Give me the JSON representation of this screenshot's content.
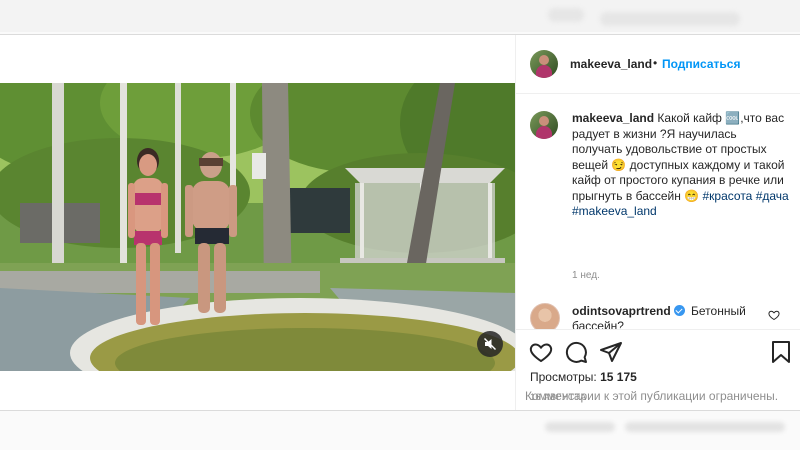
{
  "post": {
    "username": "makeeva_land",
    "dot": "•",
    "follow_label": "Подписаться",
    "caption_text": "Какой кайф 🆒,что вас радует в жизни ?Я научилась получать удовольствие от простых вещей 😏 доступных каждому и такой кайф от простого купания в речке или прыгнуть в бассейн 😁",
    "hashtags": [
      "#красота",
      "#дача",
      "#makeeva_land"
    ],
    "time_ago": "1 нед.",
    "views_label": "Просмотры:",
    "views_count": "15 175",
    "date": "16 АВГУСТА"
  },
  "comment": {
    "username": "odintsovaprtrend",
    "text": "Бетонный бассейн?"
  },
  "footer": {
    "restricted_text": "Комментарии к этой публикации ограничены."
  },
  "icons": {
    "like": "heart-icon",
    "comment": "comment-icon",
    "share": "share-icon",
    "save": "bookmark-icon",
    "mute": "muted-speaker-icon"
  },
  "colors": {
    "link": "#0095f6",
    "hashtag": "#00376b",
    "secondary": "#8e8e8e"
  }
}
